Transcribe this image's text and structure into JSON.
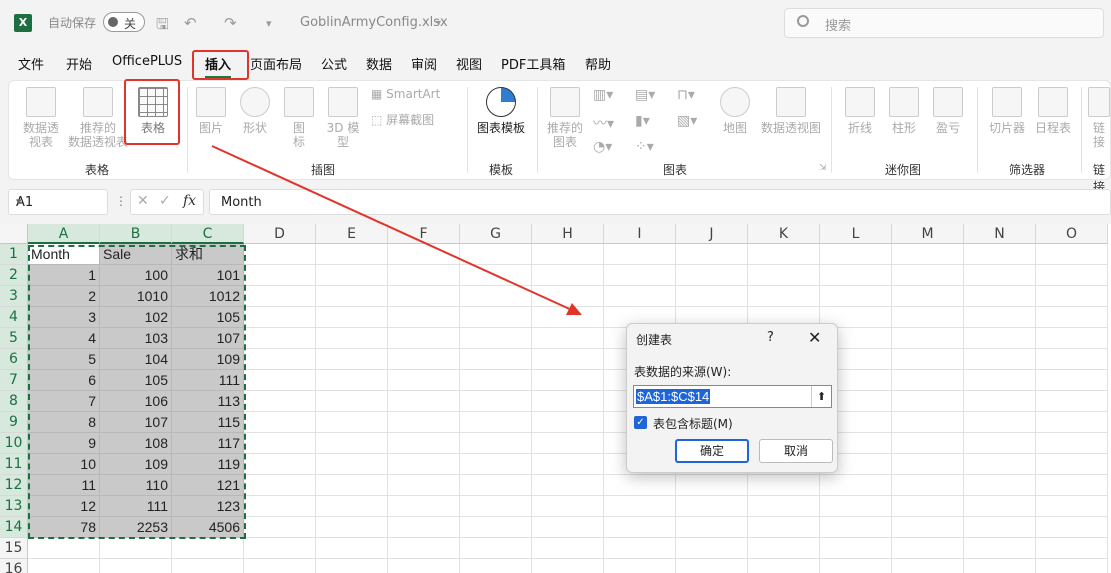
{
  "titlebar": {
    "autosave_label": "自动保存",
    "autosave_state": "关",
    "filename": "GoblinArmyConfig.xlsx",
    "search_placeholder": "搜索"
  },
  "menu": [
    "文件",
    "开始",
    "OfficePLUS",
    "插入",
    "页面布局",
    "公式",
    "数据",
    "审阅",
    "视图",
    "PDF工具箱",
    "帮助"
  ],
  "active_menu": "插入",
  "ribbon": {
    "pivot": "数据透\n视表",
    "recommended_pivot": "推荐的\n数据透视表",
    "table": "表格",
    "picture": "图片",
    "shapes": "形状",
    "icons": "图\n标",
    "model3d": "3D 模\n型",
    "smartart": "SmartArt",
    "screenshot": "屏幕截图",
    "chart_template": "图表模板",
    "recommended_chart": "推荐的\n图表",
    "map": "地图",
    "pivot_chart": "数据透视图",
    "sparkline_line": "折线",
    "sparkline_column": "柱形",
    "sparkline_winloss": "盈亏",
    "slicer": "切片器",
    "timeline": "日程表",
    "link": "链\n接",
    "groups": {
      "tables": "表格",
      "illustrations": "插图",
      "templates": "模板",
      "charts": "图表",
      "sparklines": "迷你图",
      "filters": "筛选器",
      "links": "链接"
    }
  },
  "formula_bar": {
    "name_box": "A1",
    "content": "Month"
  },
  "sheet": {
    "columns": [
      "A",
      "B",
      "C",
      "D",
      "E",
      "F",
      "G",
      "H",
      "I",
      "J",
      "K",
      "L",
      "M",
      "N",
      "O"
    ],
    "rows": [
      [
        "Month",
        "Sale",
        "求和"
      ],
      [
        "1",
        "100",
        "101"
      ],
      [
        "2",
        "1010",
        "1012"
      ],
      [
        "3",
        "102",
        "105"
      ],
      [
        "4",
        "103",
        "107"
      ],
      [
        "5",
        "104",
        "109"
      ],
      [
        "6",
        "105",
        "111"
      ],
      [
        "7",
        "106",
        "113"
      ],
      [
        "8",
        "107",
        "115"
      ],
      [
        "9",
        "108",
        "117"
      ],
      [
        "10",
        "109",
        "119"
      ],
      [
        "11",
        "110",
        "121"
      ],
      [
        "12",
        "111",
        "123"
      ],
      [
        "78",
        "2253",
        "4506"
      ],
      [
        "",
        "",
        ""
      ],
      [
        "",
        "",
        ""
      ]
    ]
  },
  "dialog": {
    "title": "创建表",
    "help": "?",
    "close": "✕",
    "source_label": "表数据的来源(W):",
    "range": "$A$1:$C$14",
    "has_headers_label": "表包含标题(M)",
    "has_headers": true,
    "ok": "确定",
    "cancel": "取消"
  },
  "annotation_color": "#e0352b"
}
